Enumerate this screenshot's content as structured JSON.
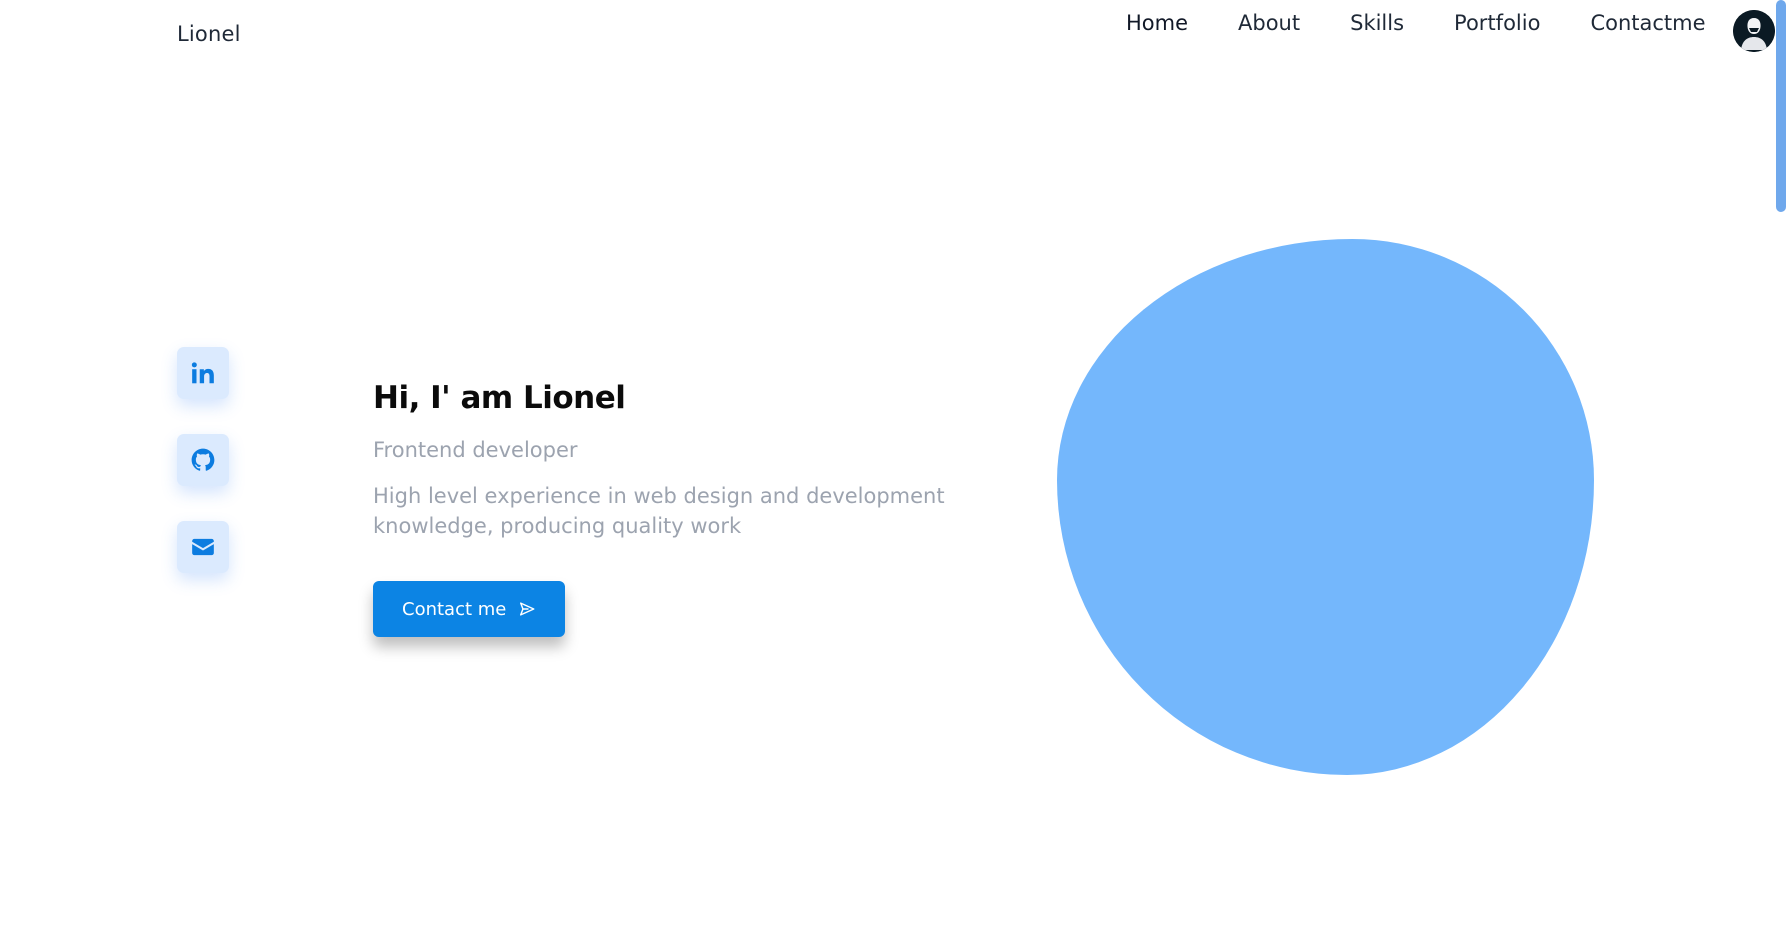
{
  "header": {
    "logo": "Lionel",
    "nav": [
      {
        "label": "Home"
      },
      {
        "label": "About"
      },
      {
        "label": "Skills"
      },
      {
        "label": "Portfolio"
      },
      {
        "label": "Contactme"
      }
    ],
    "avatar_icon": "avatar-icon"
  },
  "social": [
    {
      "icon": "linkedin-icon"
    },
    {
      "icon": "github-icon"
    },
    {
      "icon": "mail-icon"
    }
  ],
  "hero": {
    "title": "Hi, I' am Lionel",
    "subtitle": "Frontend developer",
    "description": "High level experience in web design and development knowledge, producing quality work",
    "button_label": "Contact me",
    "button_icon": "send-icon"
  },
  "colors": {
    "accent": "#0c84e4",
    "blob": "#74b7fc",
    "social_bg": "#dbeafe",
    "muted_text": "#9ca3af"
  }
}
